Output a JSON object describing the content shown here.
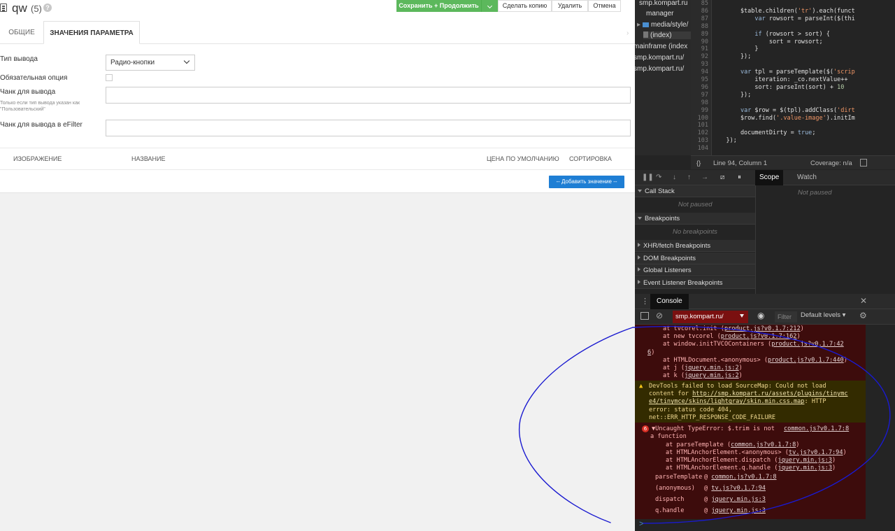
{
  "header": {
    "title": "qw",
    "count": "(5)",
    "help": "?",
    "save_label": "Сохранить + Продолжить",
    "copy_label": "Сделать копию",
    "delete_label": "Удалить",
    "cancel_label": "Отмена"
  },
  "tabs": [
    {
      "label": "ОБЩИЕ"
    },
    {
      "label": "ЗНАЧЕНИЯ ПАРАМЕТРА"
    }
  ],
  "form": {
    "output_type_label": "Тип вывода",
    "output_type_value": "Радио-кнопки",
    "required_label": "Обязательная опция",
    "chunk_label": "Чанк для вывода",
    "chunk_hint": "Только если тип вывода указан как \"Пользовательский\"",
    "efilter_chunk_label": "Чанк для вывода в eFilter"
  },
  "grid": {
    "col_image": "ИЗОБРАЖЕНИЕ",
    "col_name": "НАЗВАНИЕ",
    "col_price": "ЦЕНА ПО УМОЛЧАНИЮ",
    "col_sort": "СОРТИРОВКА",
    "add_label": "-- Добавить значение --"
  },
  "devtools": {
    "files": [
      {
        "label": "smp.kompart.ru",
        "kind": "text"
      },
      {
        "label": "manager",
        "kind": "text"
      },
      {
        "label": "media/style/",
        "kind": "folder"
      },
      {
        "label": "(index)",
        "kind": "file"
      },
      {
        "label": "mainframe (index",
        "kind": "text"
      },
      {
        "label": "smp.kompart.ru/",
        "kind": "text"
      },
      {
        "label": "smp.kompart.ru/",
        "kind": "text"
      }
    ],
    "line_numbers": [
      "85",
      "86",
      "87",
      "88",
      "89",
      "90",
      "91",
      "92",
      "93",
      "94",
      "95",
      "96",
      "97",
      "98",
      "99",
      "100",
      "101",
      "102",
      "103",
      "104"
    ],
    "code_lines": [
      "",
      "        $table.children('tr').each(funct",
      "            var rowsort = parseInt($(thi",
      "",
      "            if (rowsort > sort) {",
      "                sort = rowsort;",
      "            }",
      "        });",
      "",
      "        var tpl = parseTemplate($('scrip",
      "            iteration: _co.nextValue++",
      "            sort: parseInt(sort) + 10",
      "        });",
      "",
      "        var $row = $(tpl).addClass('dirt",
      "        $row.find('.value-image').initIm",
      "",
      "        documentDirty = true;",
      "    });",
      ""
    ],
    "status_braces": "{}",
    "status_position": "Line 94, Column 1",
    "status_coverage": "Coverage: n/a",
    "scope_tab": "Scope",
    "watch_tab": "Watch",
    "not_paused": "Not paused",
    "call_stack": "Call Stack",
    "call_stack_msg": "Not paused",
    "breakpoints": "Breakpoints",
    "breakpoints_msg": "No breakpoints",
    "xhr_breakpoints": "XHR/fetch Breakpoints",
    "dom_breakpoints": "DOM Breakpoints",
    "global_listeners": "Global Listeners",
    "event_breakpoints": "Event Listener Breakpoints",
    "console_tab": "Console",
    "context": "smp.kompart.ru/",
    "filter_placeholder": "Filter",
    "levels": "Default levels ▾",
    "console": {
      "trace1": [
        {
          "pre": "at tvcorel.init (",
          "link": "product.js?v0.1.7:212",
          "post": ")"
        },
        {
          "pre": "at new tvcorel (",
          "link": "product.js?v0.1.7:162",
          "post": ")"
        },
        {
          "pre": "at window.initTVCOContainers (",
          "link": "product.js?v0.1.7:42",
          "post": ""
        },
        {
          "pre": "",
          "link": "6",
          "post": ")"
        },
        {
          "pre": "at HTMLDocument.<anonymous> (",
          "link": "product.js?v0.1.7:440",
          "post": ")"
        },
        {
          "pre": "at j (",
          "link": "jquery.min.js:2",
          "post": ")"
        },
        {
          "pre": "at k (",
          "link": "jquery.min.js:2",
          "post": ")"
        }
      ],
      "warning_lines": [
        {
          "pre": "DevTools failed to load SourceMap: Could not load",
          "link": "",
          "post": ""
        },
        {
          "pre": "content for ",
          "link": "http://smp.kompart.ru/assets/plugins/tinymc",
          "post": ""
        },
        {
          "pre": "",
          "link": "e4/tinymce/skins/lightgray/skin.min.css.map",
          "post": ": HTTP"
        },
        {
          "pre": "error: status code 404,",
          "link": "",
          "post": ""
        },
        {
          "pre": "net::ERR_HTTP_RESPONSE_CODE_FAILURE",
          "link": "",
          "post": ""
        }
      ],
      "error_count": "6",
      "error_head": "▼Uncaught TypeError: $.trim is not",
      "error_head_link": "common.js?v0.1.7:8",
      "error_head2": "a function",
      "trace2": [
        {
          "pre": "at parseTemplate (",
          "link": "common.js?v0.1.7:8",
          "post": ")"
        },
        {
          "pre": "at HTMLAnchorElement.<anonymous> (",
          "link": "tv.js?v0.1.7:94",
          "post": ")"
        },
        {
          "pre": "at HTMLAnchorElement.dispatch (",
          "link": "jquery.min.js:3",
          "post": ")"
        },
        {
          "pre": "at HTMLAnchorElement.q.handle (",
          "link": "jquery.min.js:3",
          "post": ")"
        }
      ],
      "frames": [
        {
          "fn": "parseTemplate",
          "at": "@",
          "link": "common.js?v0.1.7:8"
        },
        {
          "fn": "(anonymous)",
          "at": "@",
          "link": "tv.js?v0.1.7:94"
        },
        {
          "fn": "dispatch",
          "at": "@",
          "link": "jquery.min.js:3"
        },
        {
          "fn": "q.handle",
          "at": "@",
          "link": "jquery.min.js:3"
        }
      ],
      "prompt": ">"
    }
  },
  "colors": {
    "save_green": "#5cb85c",
    "add_blue": "#1e7ed4",
    "annotation_blue": "#1a1ad0",
    "console_error_bg": "#3d0c0c",
    "console_warn_bg": "#332b00"
  }
}
